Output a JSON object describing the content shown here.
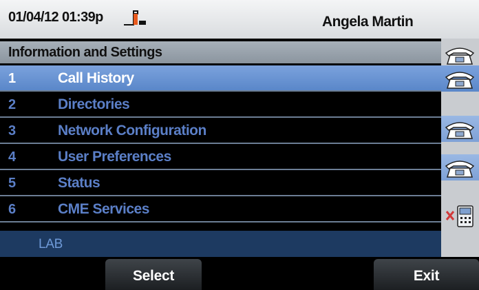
{
  "header": {
    "datetime": "01/04/12 01:39p",
    "user": "Angela Martin",
    "status_icon": "off-hook-handset-icon"
  },
  "title": "Information and Settings",
  "menu": {
    "items": [
      {
        "num": "1",
        "label": "Call History",
        "selected": true
      },
      {
        "num": "2",
        "label": "Directories",
        "selected": false
      },
      {
        "num": "3",
        "label": "Network Configuration",
        "selected": false
      },
      {
        "num": "4",
        "label": "User Preferences",
        "selected": false
      },
      {
        "num": "5",
        "label": "Status",
        "selected": false
      },
      {
        "num": "6",
        "label": "CME Services",
        "selected": false
      }
    ]
  },
  "line_keys": [
    {
      "icon": "phone-line-icon"
    },
    {
      "icon": "phone-line-icon"
    },
    {
      "icon": "phone-line-icon"
    },
    {
      "icon": "phone-line-icon"
    },
    {
      "icon": "disconnected-phone-icon"
    }
  ],
  "status_strip": {
    "text": "LAB"
  },
  "softkeys": {
    "select": "Select",
    "exit": "Exit"
  },
  "colors": {
    "selected_row": "#6a93d3",
    "menu_text": "#5b7fc7",
    "status_strip": "#1d3a61",
    "softkey_bg": "#2b2f33"
  }
}
